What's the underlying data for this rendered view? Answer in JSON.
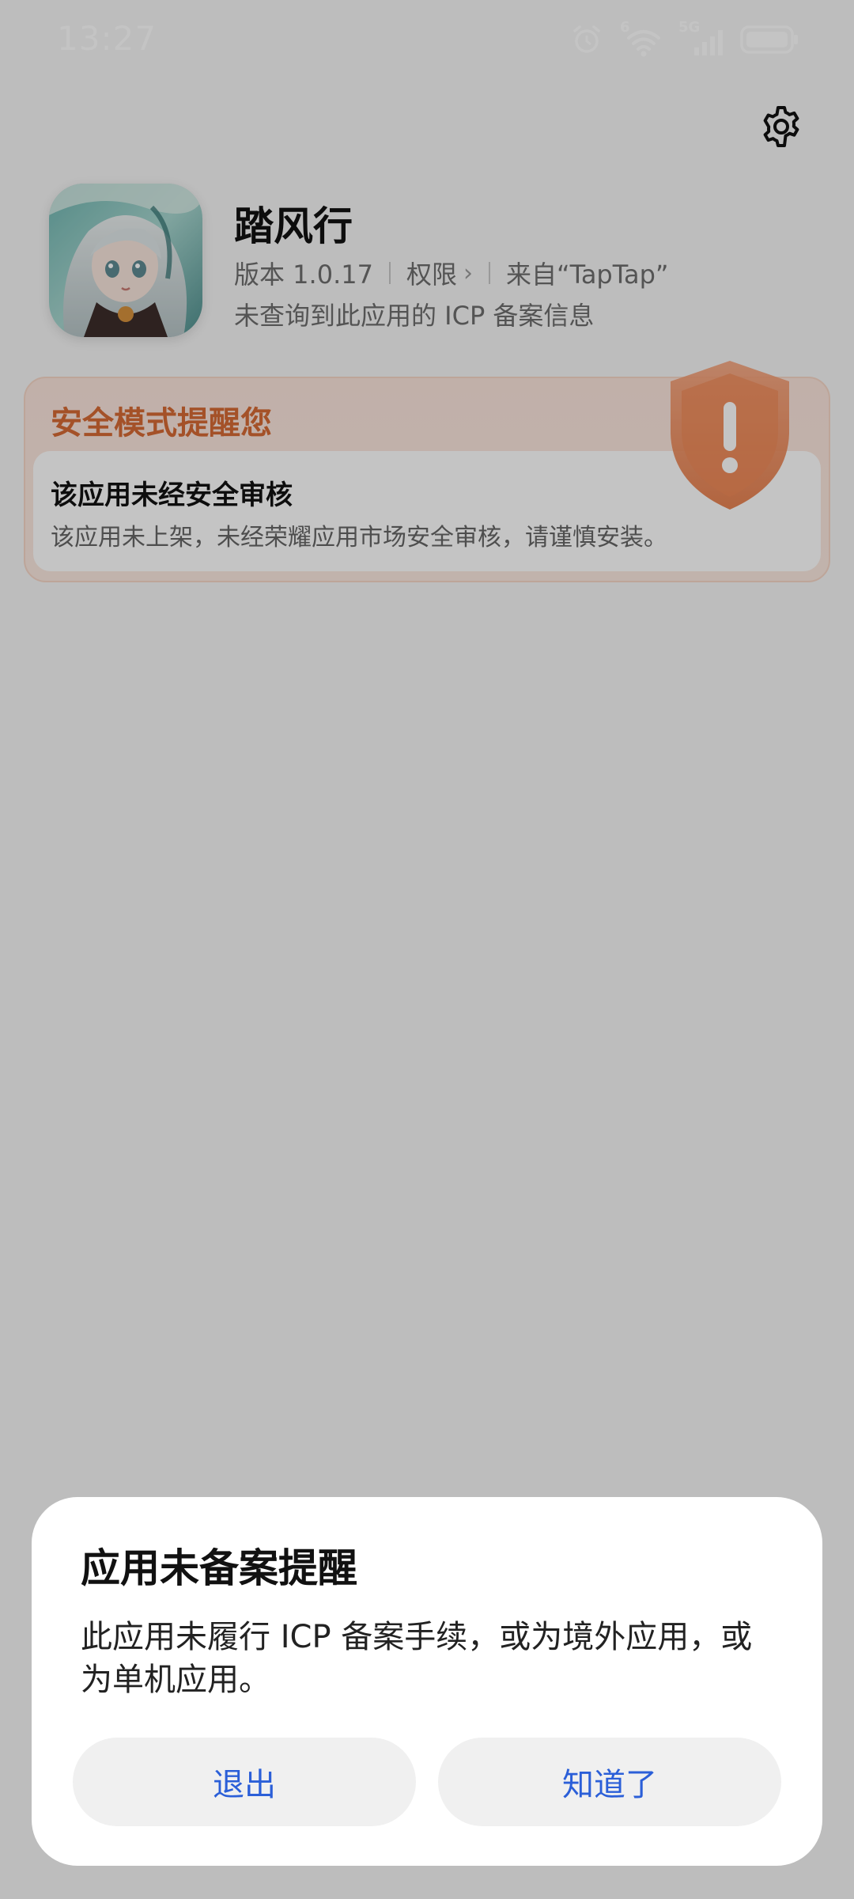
{
  "status_bar": {
    "time": "13:27",
    "wifi_badge": "6",
    "network": "5G",
    "icons": [
      "alarm-icon",
      "wifi-icon",
      "signal-icon",
      "battery-icon"
    ]
  },
  "header": {
    "settings_icon": "gear-icon"
  },
  "app": {
    "name": "踏风行",
    "version": "版本 1.0.17",
    "permissions": "权限",
    "source": "来自“TapTap”",
    "icp_status": "未查询到此应用的 ICP 备案信息"
  },
  "safety": {
    "title": "安全模式提醒您",
    "item_title": "该应用未经安全审核",
    "item_desc": "该应用未上架，未经荣耀应用市场安全审核，请谨慎安装。",
    "accent_color": "#d66a34"
  },
  "dialog": {
    "title": "应用未备案提醒",
    "body": "此应用未履行 ICP 备案手续，或为境外应用，或为单机应用。",
    "exit_label": "退出",
    "ok_label": "知道了",
    "button_color": "#2b5fd8"
  }
}
